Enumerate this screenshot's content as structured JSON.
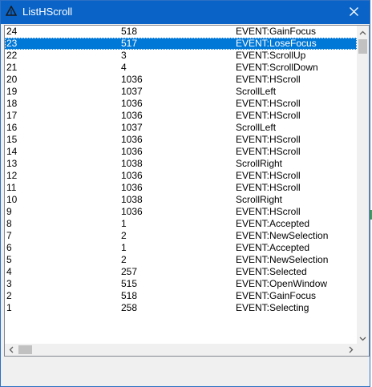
{
  "window": {
    "title": "ListHScroll",
    "accent_color": "#0a64c8",
    "selection_color": "#0078d7"
  },
  "list": {
    "selected_index": 1,
    "rows": [
      {
        "id": "24",
        "code": "518",
        "event": "EVENT:GainFocus"
      },
      {
        "id": "23",
        "code": "517",
        "event": "EVENT:LoseFocus"
      },
      {
        "id": "22",
        "code": "3",
        "event": "EVENT:ScrollUp"
      },
      {
        "id": "21",
        "code": "4",
        "event": "EVENT:ScrollDown"
      },
      {
        "id": "20",
        "code": "1036",
        "event": "EVENT:HScroll"
      },
      {
        "id": "19",
        "code": "1037",
        "event": " ScrollLeft"
      },
      {
        "id": "18",
        "code": "1036",
        "event": "EVENT:HScroll"
      },
      {
        "id": "17",
        "code": "1036",
        "event": "EVENT:HScroll"
      },
      {
        "id": "16",
        "code": "1037",
        "event": " ScrollLeft"
      },
      {
        "id": "15",
        "code": "1036",
        "event": "EVENT:HScroll"
      },
      {
        "id": "14",
        "code": "1036",
        "event": "EVENT:HScroll"
      },
      {
        "id": "13",
        "code": "1038",
        "event": " ScrollRight"
      },
      {
        "id": "12",
        "code": "1036",
        "event": "EVENT:HScroll"
      },
      {
        "id": "11",
        "code": "1036",
        "event": "EVENT:HScroll"
      },
      {
        "id": "10",
        "code": "1038",
        "event": " ScrollRight"
      },
      {
        "id": "9",
        "code": "1036",
        "event": "EVENT:HScroll"
      },
      {
        "id": "8",
        "code": "1",
        "event": "EVENT:Accepted"
      },
      {
        "id": "7",
        "code": "2",
        "event": "EVENT:NewSelection"
      },
      {
        "id": "6",
        "code": "1",
        "event": "EVENT:Accepted"
      },
      {
        "id": "5",
        "code": "2",
        "event": "EVENT:NewSelection"
      },
      {
        "id": "4",
        "code": "257",
        "event": "EVENT:Selected"
      },
      {
        "id": "3",
        "code": "515",
        "event": "EVENT:OpenWindow"
      },
      {
        "id": "2",
        "code": "518",
        "event": "EVENT:GainFocus"
      },
      {
        "id": "1",
        "code": "258",
        "event": "EVENT:Selecting"
      }
    ]
  },
  "icons": {
    "app": "triangle-app-icon",
    "close": "close-icon",
    "scroll_up": "chevron-up-icon",
    "scroll_down": "chevron-down-icon",
    "scroll_left": "chevron-left-icon",
    "scroll_right": "chevron-right-icon"
  }
}
